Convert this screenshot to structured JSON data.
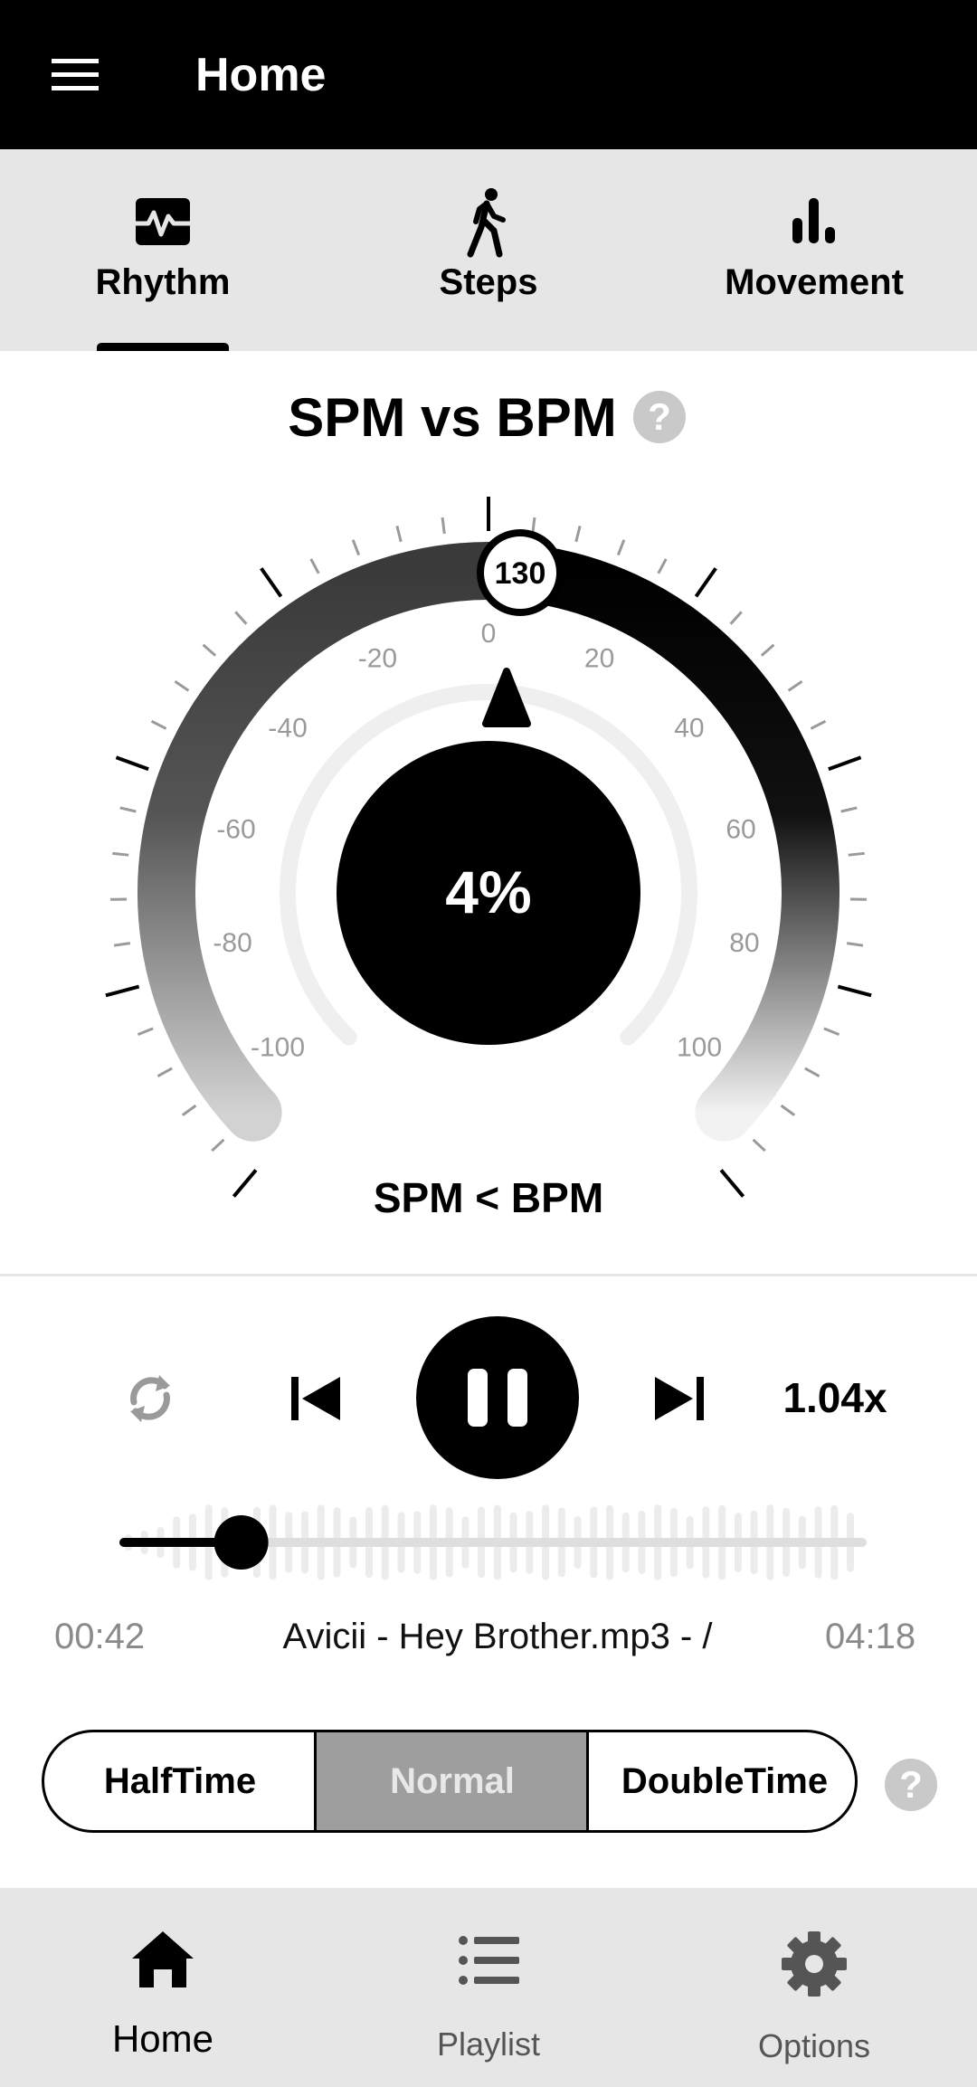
{
  "appbar": {
    "title": "Home",
    "menu_icon": "hamburger-menu-icon"
  },
  "tabs": [
    {
      "label": "Rhythm",
      "icon": "heart-pulse-icon",
      "active": true
    },
    {
      "label": "Steps",
      "icon": "walking-person-icon",
      "active": false
    },
    {
      "label": "Movement",
      "icon": "bar-chart-icon",
      "active": false
    }
  ],
  "gauge": {
    "title": "SPM vs BPM",
    "help": "?",
    "bpm": "130",
    "percent": "4%",
    "status": "SPM < BPM",
    "scale_labels": [
      "-100",
      "-80",
      "-60",
      "-40",
      "-20",
      "0",
      "20",
      "40",
      "60",
      "80",
      "100"
    ],
    "colors": {
      "dark": "#000000",
      "light": "#d6d6d6",
      "inner_track": "#efefef"
    }
  },
  "player": {
    "speed": "1.04x",
    "current_time": "00:42",
    "total_time": "04:18",
    "track": "Avicii - Hey Brother.mp3 - /",
    "progress": 0.163
  },
  "tempo_mode": {
    "options": [
      "HalfTime",
      "Normal",
      "DoubleTime"
    ],
    "selected": "Normal",
    "help": "?"
  },
  "bottom_nav": [
    {
      "label": "Home",
      "icon": "home-icon",
      "active": true
    },
    {
      "label": "Playlist",
      "icon": "list-icon",
      "active": false
    },
    {
      "label": "Options",
      "icon": "gear-icon",
      "active": false
    }
  ]
}
